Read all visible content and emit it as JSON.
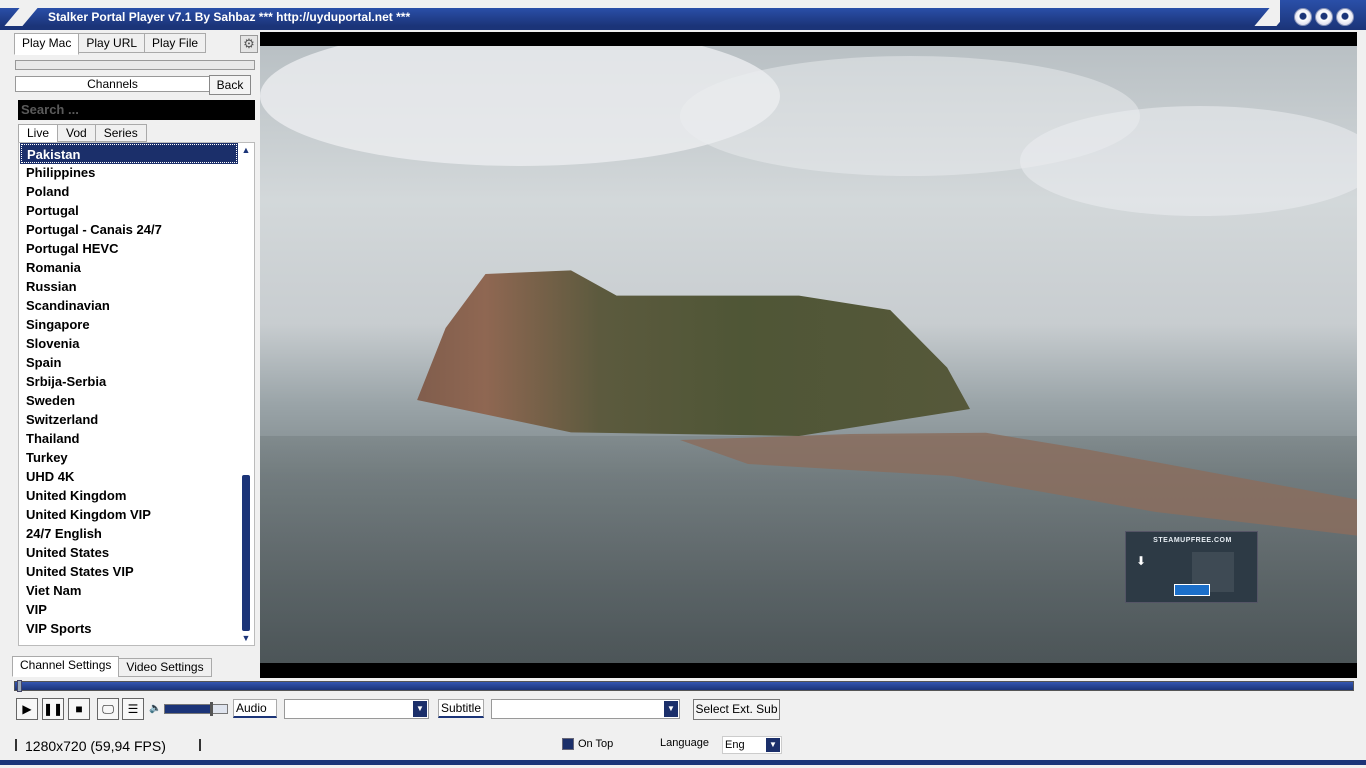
{
  "window": {
    "title": "Stalker Portal Player v7.1 By Sahbaz  *** http://uyduportal.net ***"
  },
  "left_panel": {
    "top_tabs": [
      "Play Mac",
      "Play URL",
      "Play File"
    ],
    "settings_icon": "gear-icon",
    "header_label": "Channels",
    "back_label": "Back",
    "search_placeholder": "Search ...",
    "sub_tabs": [
      "Live",
      "Vod",
      "Series"
    ],
    "channels": [
      "Pakistan",
      "Philippines",
      "Poland",
      "Portugal",
      "Portugal - Canais 24/7",
      "Portugal HEVC",
      "Romania",
      "Russian",
      "Scandinavian",
      "Singapore",
      "Slovenia",
      "Spain",
      "Srbija-Serbia",
      "Sweden",
      "Switzerland",
      "Thailand",
      "Turkey",
      "UHD 4K",
      "United Kingdom",
      "United Kingdom VIP",
      "24/7 English",
      "United States",
      "United States VIP",
      "Viet Nam",
      "VIP",
      "VIP Sports"
    ],
    "selected_channel": "Pakistan",
    "bottom_tabs": [
      "Channel Settings",
      "Video Settings"
    ]
  },
  "video": {
    "overlay_text": "STEAMUPFREE.COM"
  },
  "controls": {
    "play_icon": "play-icon",
    "pause_icon": "pause-icon",
    "stop_icon": "stop-icon",
    "screen_icon": "monitor-icon",
    "playlist_icon": "playlist-icon",
    "volume_icon": "speaker-icon",
    "volume_level": 0.75,
    "audio_label": "Audio",
    "audio_value": "",
    "subtitle_label": "Subtitle",
    "subtitle_value": "",
    "ext_sub_label": "Select Ext. Sub"
  },
  "status": {
    "resolution": "1280x720  (59,94 FPS)",
    "on_top_label": "On Top",
    "language_label": "Language",
    "language_value": "Eng"
  },
  "colors": {
    "accent": "#1b3478",
    "selection": "#1b2f6a"
  }
}
